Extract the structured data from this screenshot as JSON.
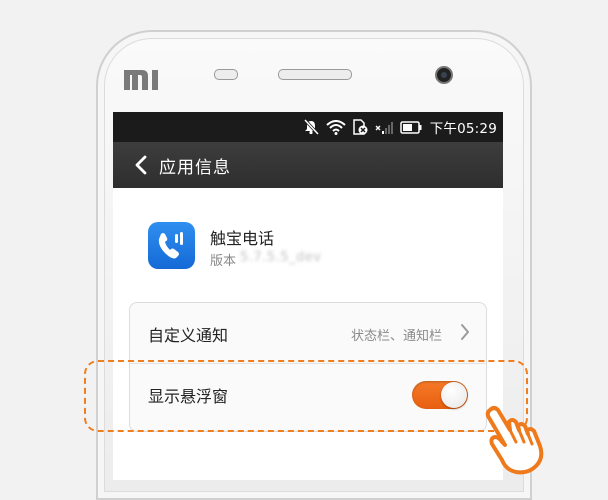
{
  "device": {
    "brand_logo_text": "MI"
  },
  "status_bar": {
    "time": "下午05:29"
  },
  "title_bar": {
    "title": "应用信息"
  },
  "app": {
    "name": "触宝电话",
    "version_label": "版本",
    "version_value": "5.7.5.5_dev"
  },
  "settings": [
    {
      "label": "自定义通知",
      "value": "状态栏、通知栏",
      "type": "link"
    },
    {
      "label": "显示悬浮窗",
      "type": "toggle",
      "on": true
    }
  ],
  "colors": {
    "accent": "#F07D1E",
    "toggle_on": "#EC6A17",
    "app_icon": "#1E7BE5",
    "titlebar": "#353535",
    "statusbar": "#1B1B1B"
  },
  "icons": {
    "status": [
      "mute-icon",
      "wifi-icon",
      "sim-icon",
      "signal-icon",
      "battery-icon"
    ],
    "nav": "back-arrow-icon",
    "row": "chevron-right-icon",
    "pointer": "hand-pointer-icon"
  }
}
